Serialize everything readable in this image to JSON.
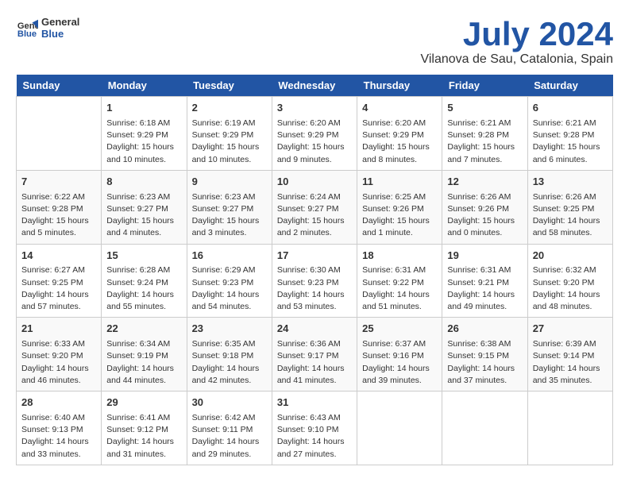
{
  "header": {
    "logo_line1": "General",
    "logo_line2": "Blue",
    "month": "July 2024",
    "location": "Vilanova de Sau, Catalonia, Spain"
  },
  "days_of_week": [
    "Sunday",
    "Monday",
    "Tuesday",
    "Wednesday",
    "Thursday",
    "Friday",
    "Saturday"
  ],
  "weeks": [
    [
      {
        "num": "",
        "empty": true
      },
      {
        "num": "1",
        "sunrise": "Sunrise: 6:18 AM",
        "sunset": "Sunset: 9:29 PM",
        "daylight": "Daylight: 15 hours and 10 minutes."
      },
      {
        "num": "2",
        "sunrise": "Sunrise: 6:19 AM",
        "sunset": "Sunset: 9:29 PM",
        "daylight": "Daylight: 15 hours and 10 minutes."
      },
      {
        "num": "3",
        "sunrise": "Sunrise: 6:20 AM",
        "sunset": "Sunset: 9:29 PM",
        "daylight": "Daylight: 15 hours and 9 minutes."
      },
      {
        "num": "4",
        "sunrise": "Sunrise: 6:20 AM",
        "sunset": "Sunset: 9:29 PM",
        "daylight": "Daylight: 15 hours and 8 minutes."
      },
      {
        "num": "5",
        "sunrise": "Sunrise: 6:21 AM",
        "sunset": "Sunset: 9:28 PM",
        "daylight": "Daylight: 15 hours and 7 minutes."
      },
      {
        "num": "6",
        "sunrise": "Sunrise: 6:21 AM",
        "sunset": "Sunset: 9:28 PM",
        "daylight": "Daylight: 15 hours and 6 minutes."
      }
    ],
    [
      {
        "num": "7",
        "sunrise": "Sunrise: 6:22 AM",
        "sunset": "Sunset: 9:28 PM",
        "daylight": "Daylight: 15 hours and 5 minutes."
      },
      {
        "num": "8",
        "sunrise": "Sunrise: 6:23 AM",
        "sunset": "Sunset: 9:27 PM",
        "daylight": "Daylight: 15 hours and 4 minutes."
      },
      {
        "num": "9",
        "sunrise": "Sunrise: 6:23 AM",
        "sunset": "Sunset: 9:27 PM",
        "daylight": "Daylight: 15 hours and 3 minutes."
      },
      {
        "num": "10",
        "sunrise": "Sunrise: 6:24 AM",
        "sunset": "Sunset: 9:27 PM",
        "daylight": "Daylight: 15 hours and 2 minutes."
      },
      {
        "num": "11",
        "sunrise": "Sunrise: 6:25 AM",
        "sunset": "Sunset: 9:26 PM",
        "daylight": "Daylight: 15 hours and 1 minute."
      },
      {
        "num": "12",
        "sunrise": "Sunrise: 6:26 AM",
        "sunset": "Sunset: 9:26 PM",
        "daylight": "Daylight: 15 hours and 0 minutes."
      },
      {
        "num": "13",
        "sunrise": "Sunrise: 6:26 AM",
        "sunset": "Sunset: 9:25 PM",
        "daylight": "Daylight: 14 hours and 58 minutes."
      }
    ],
    [
      {
        "num": "14",
        "sunrise": "Sunrise: 6:27 AM",
        "sunset": "Sunset: 9:25 PM",
        "daylight": "Daylight: 14 hours and 57 minutes."
      },
      {
        "num": "15",
        "sunrise": "Sunrise: 6:28 AM",
        "sunset": "Sunset: 9:24 PM",
        "daylight": "Daylight: 14 hours and 55 minutes."
      },
      {
        "num": "16",
        "sunrise": "Sunrise: 6:29 AM",
        "sunset": "Sunset: 9:23 PM",
        "daylight": "Daylight: 14 hours and 54 minutes."
      },
      {
        "num": "17",
        "sunrise": "Sunrise: 6:30 AM",
        "sunset": "Sunset: 9:23 PM",
        "daylight": "Daylight: 14 hours and 53 minutes."
      },
      {
        "num": "18",
        "sunrise": "Sunrise: 6:31 AM",
        "sunset": "Sunset: 9:22 PM",
        "daylight": "Daylight: 14 hours and 51 minutes."
      },
      {
        "num": "19",
        "sunrise": "Sunrise: 6:31 AM",
        "sunset": "Sunset: 9:21 PM",
        "daylight": "Daylight: 14 hours and 49 minutes."
      },
      {
        "num": "20",
        "sunrise": "Sunrise: 6:32 AM",
        "sunset": "Sunset: 9:20 PM",
        "daylight": "Daylight: 14 hours and 48 minutes."
      }
    ],
    [
      {
        "num": "21",
        "sunrise": "Sunrise: 6:33 AM",
        "sunset": "Sunset: 9:20 PM",
        "daylight": "Daylight: 14 hours and 46 minutes."
      },
      {
        "num": "22",
        "sunrise": "Sunrise: 6:34 AM",
        "sunset": "Sunset: 9:19 PM",
        "daylight": "Daylight: 14 hours and 44 minutes."
      },
      {
        "num": "23",
        "sunrise": "Sunrise: 6:35 AM",
        "sunset": "Sunset: 9:18 PM",
        "daylight": "Daylight: 14 hours and 42 minutes."
      },
      {
        "num": "24",
        "sunrise": "Sunrise: 6:36 AM",
        "sunset": "Sunset: 9:17 PM",
        "daylight": "Daylight: 14 hours and 41 minutes."
      },
      {
        "num": "25",
        "sunrise": "Sunrise: 6:37 AM",
        "sunset": "Sunset: 9:16 PM",
        "daylight": "Daylight: 14 hours and 39 minutes."
      },
      {
        "num": "26",
        "sunrise": "Sunrise: 6:38 AM",
        "sunset": "Sunset: 9:15 PM",
        "daylight": "Daylight: 14 hours and 37 minutes."
      },
      {
        "num": "27",
        "sunrise": "Sunrise: 6:39 AM",
        "sunset": "Sunset: 9:14 PM",
        "daylight": "Daylight: 14 hours and 35 minutes."
      }
    ],
    [
      {
        "num": "28",
        "sunrise": "Sunrise: 6:40 AM",
        "sunset": "Sunset: 9:13 PM",
        "daylight": "Daylight: 14 hours and 33 minutes."
      },
      {
        "num": "29",
        "sunrise": "Sunrise: 6:41 AM",
        "sunset": "Sunset: 9:12 PM",
        "daylight": "Daylight: 14 hours and 31 minutes."
      },
      {
        "num": "30",
        "sunrise": "Sunrise: 6:42 AM",
        "sunset": "Sunset: 9:11 PM",
        "daylight": "Daylight: 14 hours and 29 minutes."
      },
      {
        "num": "31",
        "sunrise": "Sunrise: 6:43 AM",
        "sunset": "Sunset: 9:10 PM",
        "daylight": "Daylight: 14 hours and 27 minutes."
      },
      {
        "num": "",
        "empty": true
      },
      {
        "num": "",
        "empty": true
      },
      {
        "num": "",
        "empty": true
      }
    ]
  ]
}
